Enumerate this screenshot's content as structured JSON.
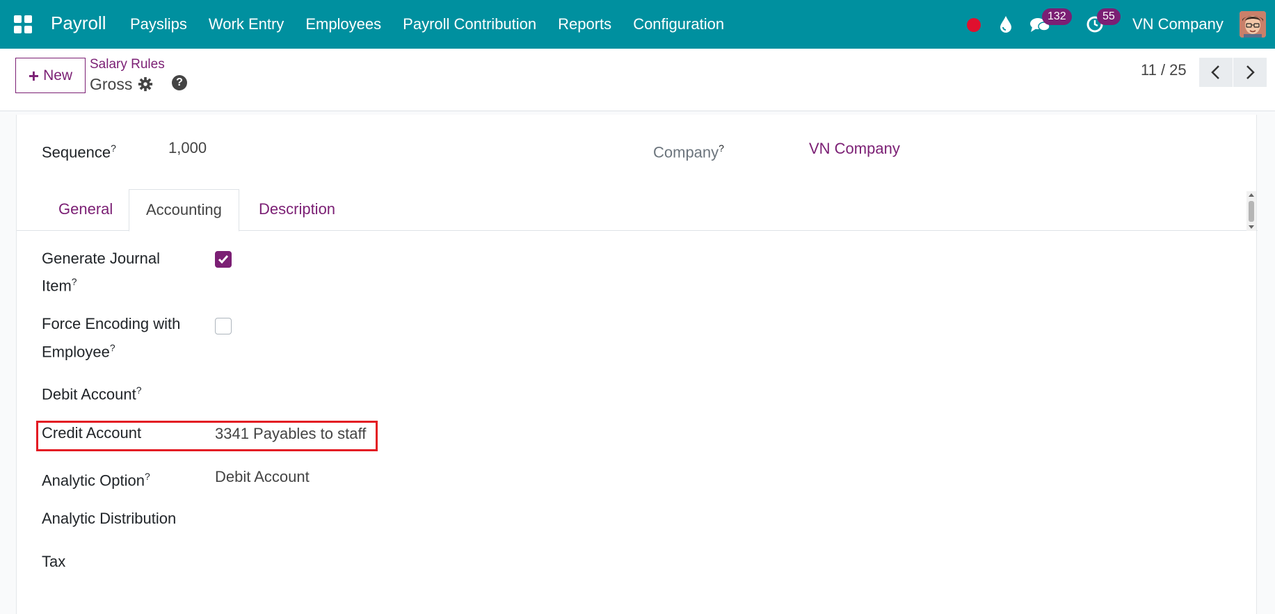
{
  "navbar": {
    "brand": "Payroll",
    "menu": [
      {
        "label": "Payslips"
      },
      {
        "label": "Work Entry"
      },
      {
        "label": "Employees"
      },
      {
        "label": "Payroll Contribution"
      },
      {
        "label": "Reports"
      },
      {
        "label": "Configuration"
      }
    ],
    "chat_count": "132",
    "activity_count": "55",
    "company": "VN Company",
    "colors": {
      "bar": "#00909f",
      "badge": "#7b1f74",
      "record": "#e0102e"
    }
  },
  "control": {
    "new_label": "New",
    "breadcrumb": "Salary Rules",
    "record_title": "Gross",
    "help_glyph": "?",
    "pager": "11 / 25"
  },
  "form": {
    "sequence_label": "Sequence",
    "sequence_value": "1,000",
    "company_label": "Company",
    "company_value": "VN Company",
    "help_mark": "?",
    "tabs": [
      {
        "label": "General",
        "active": false
      },
      {
        "label": "Accounting",
        "active": true
      },
      {
        "label": "Description",
        "active": false
      }
    ],
    "fields": {
      "generate_journal_label_1": "Generate Journal",
      "generate_journal_label_2": "Item",
      "generate_journal_checked": true,
      "force_encoding_label_1": "Force Encoding with",
      "force_encoding_label_2": "Employee",
      "force_encoding_checked": false,
      "debit_account_label": "Debit Account",
      "credit_account_label": "Credit Account",
      "credit_account_value": "3341 Payables to staff",
      "analytic_option_label": "Analytic Option",
      "analytic_option_value": "Debit Account",
      "analytic_distribution_label": "Analytic Distribution",
      "tax_label": "Tax"
    },
    "accent_color": "#7b1f74",
    "highlight_color": "#e31b23"
  }
}
